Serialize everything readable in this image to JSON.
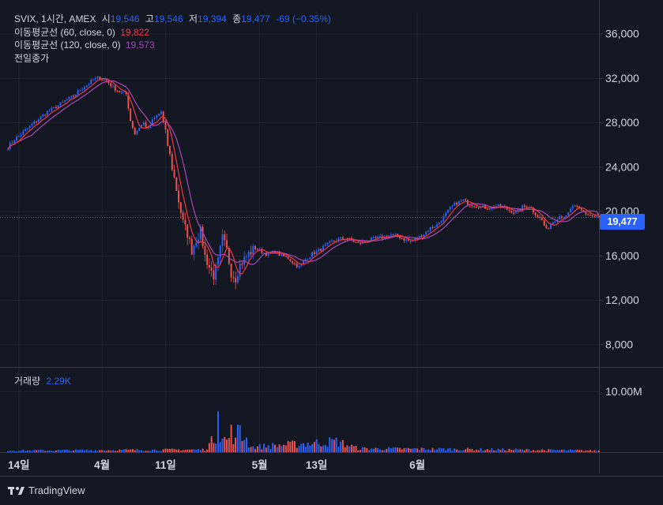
{
  "legend": {
    "symbol": "SVIX, 1시간, AMEX",
    "o_label": "시",
    "o_value": "19,546",
    "h_label": "고",
    "h_value": "19,546",
    "l_label": "저",
    "l_value": "19,394",
    "c_label": "종",
    "c_value": "19,477",
    "change": "-69 (−0.35%)",
    "ma1_label": "이동평균선 (60, close, 0)",
    "ma1_value": "19,822",
    "ma2_label": "이동평균선 (120, close, 0)",
    "ma2_value": "19,573",
    "prev_close_label": "전일종가"
  },
  "volume_legend": {
    "label": "거래량",
    "value": "2.29K"
  },
  "price_axis": [
    "36,000",
    "32,000",
    "28,000",
    "24,000",
    "20,000",
    "16,000",
    "12,000",
    "8,000"
  ],
  "volume_axis": [
    "10.00M"
  ],
  "time_axis": [
    "14일",
    "4월",
    "11일",
    "5월",
    "13일",
    "6월"
  ],
  "last_price": "19,477",
  "brand": "TradingView",
  "colors": {
    "up": "#26a69a",
    "blue": "#2962ff",
    "down": "#ef5350",
    "ma60": "#f23645",
    "ma120": "#ab47bc",
    "bg": "#131722",
    "grid": "#2a2e39",
    "text": "#d1d4dc"
  },
  "chart_data": {
    "type": "candlestick",
    "symbol": "SVIX",
    "interval": "1시간",
    "exchange": "AMEX",
    "x_ticks": [
      "14일",
      "4월",
      "11일",
      "5월",
      "13일",
      "6월"
    ],
    "ylim": [
      6000,
      38000
    ],
    "close_path": [
      [
        0,
        25800
      ],
      [
        3,
        26500
      ],
      [
        6,
        27000
      ],
      [
        9,
        27500
      ],
      [
        12,
        28000
      ],
      [
        15,
        28500
      ],
      [
        18,
        29000
      ],
      [
        21,
        29300
      ],
      [
        24,
        29700
      ],
      [
        27,
        30100
      ],
      [
        30,
        30400
      ],
      [
        33,
        31000
      ],
      [
        36,
        31400
      ],
      [
        39,
        31900
      ],
      [
        42,
        32100
      ],
      [
        45,
        31800
      ],
      [
        48,
        31200
      ],
      [
        51,
        30800
      ],
      [
        54,
        30600
      ],
      [
        56,
        28200
      ],
      [
        58,
        27000
      ],
      [
        60,
        27600
      ],
      [
        62,
        28000
      ],
      [
        64,
        27400
      ],
      [
        66,
        28200
      ],
      [
        68,
        28600
      ],
      [
        70,
        29000
      ],
      [
        72,
        27000
      ],
      [
        74,
        25000
      ],
      [
        76,
        23000
      ],
      [
        78,
        21000
      ],
      [
        80,
        19000
      ],
      [
        82,
        18000
      ],
      [
        84,
        16500
      ],
      [
        86,
        17500
      ],
      [
        88,
        18200
      ],
      [
        90,
        16000
      ],
      [
        92,
        15000
      ],
      [
        94,
        14200
      ],
      [
        96,
        15500
      ],
      [
        98,
        17600
      ],
      [
        100,
        16500
      ],
      [
        102,
        14500
      ],
      [
        104,
        14000
      ],
      [
        106,
        15200
      ],
      [
        108,
        15700
      ],
      [
        110,
        16200
      ],
      [
        113,
        16700
      ],
      [
        116,
        16400
      ],
      [
        119,
        16100
      ],
      [
        122,
        16400
      ],
      [
        125,
        16000
      ],
      [
        128,
        15800
      ],
      [
        131,
        15300
      ],
      [
        133,
        15000
      ],
      [
        136,
        15700
      ],
      [
        139,
        16200
      ],
      [
        142,
        16500
      ],
      [
        145,
        16900
      ],
      [
        148,
        17300
      ],
      [
        151,
        17500
      ],
      [
        154,
        17600
      ],
      [
        157,
        17400
      ],
      [
        160,
        17100
      ],
      [
        163,
        17300
      ],
      [
        166,
        17500
      ],
      [
        169,
        17600
      ],
      [
        172,
        17700
      ],
      [
        175,
        17900
      ],
      [
        178,
        17800
      ],
      [
        181,
        17500
      ],
      [
        184,
        17300
      ],
      [
        187,
        17600
      ],
      [
        190,
        18000
      ],
      [
        193,
        18500
      ],
      [
        196,
        18800
      ],
      [
        199,
        19500
      ],
      [
        202,
        20300
      ],
      [
        205,
        20800
      ],
      [
        208,
        21000
      ],
      [
        211,
        20700
      ],
      [
        214,
        20500
      ],
      [
        217,
        20400
      ],
      [
        220,
        20300
      ],
      [
        223,
        20500
      ],
      [
        226,
        20400
      ],
      [
        229,
        20100
      ],
      [
        232,
        19900
      ],
      [
        235,
        20400
      ],
      [
        238,
        20500
      ],
      [
        241,
        19800
      ],
      [
        244,
        19200
      ],
      [
        246,
        18300
      ],
      [
        248,
        18900
      ],
      [
        250,
        19300
      ],
      [
        252,
        19600
      ],
      [
        255,
        19500
      ],
      [
        258,
        20500
      ],
      [
        261,
        20200
      ],
      [
        264,
        19800
      ],
      [
        267,
        19600
      ],
      [
        270,
        19477
      ]
    ],
    "volume_profile": [
      [
        0,
        0.3
      ],
      [
        90,
        0.5
      ],
      [
        92,
        1.5
      ],
      [
        94,
        2.6
      ],
      [
        95,
        3.5
      ],
      [
        96,
        11.4
      ],
      [
        97,
        3.8
      ],
      [
        98,
        2.8
      ],
      [
        100,
        2.2
      ],
      [
        102,
        3.9
      ],
      [
        104,
        2.1
      ],
      [
        106,
        5.6
      ],
      [
        107,
        2.6
      ],
      [
        108,
        3.4
      ],
      [
        110,
        1.6
      ],
      [
        112,
        1.0
      ],
      [
        150,
        2.1
      ],
      [
        160,
        0.7
      ],
      [
        200,
        0.6
      ],
      [
        270,
        0.3
      ]
    ],
    "series": [
      {
        "name": "이동평균선 (60, close, 0)",
        "color": "#f23645",
        "last": 19822
      },
      {
        "name": "이동평균선 (120, close, 0)",
        "color": "#ab47bc",
        "last": 19573
      }
    ],
    "volume_ylim": [
      0,
      14
    ],
    "volume_unit": "M"
  }
}
